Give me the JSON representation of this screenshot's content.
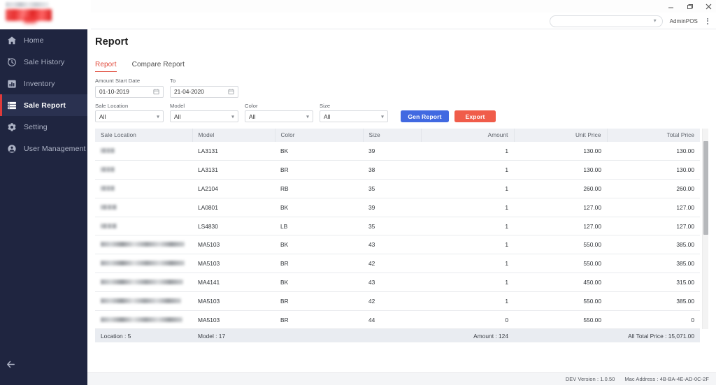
{
  "window": {
    "minimize_label": "Minimize",
    "maximize_label": "Maximize",
    "close_label": "Close"
  },
  "header": {
    "store_select_value": "",
    "store_select_placeholder": "",
    "user": "AdminPOS",
    "menu_label": "More options"
  },
  "brand": {
    "name_redacted": "",
    "logo_redacted": ""
  },
  "sidebar": {
    "items": [
      {
        "label": "Home",
        "icon": "home-icon",
        "active": false
      },
      {
        "label": "Sale History",
        "icon": "clock-history-icon",
        "active": false
      },
      {
        "label": "Inventory",
        "icon": "bar-chart-icon",
        "active": false
      },
      {
        "label": "Sale Report",
        "icon": "report-list-icon",
        "active": true
      },
      {
        "label": "Setting",
        "icon": "gear-icon",
        "active": false
      },
      {
        "label": "User Management",
        "icon": "user-icon",
        "active": false
      }
    ],
    "collapse_icon": "arrow-left-icon"
  },
  "main": {
    "page_title": "Report",
    "tabs": [
      {
        "label": "Report",
        "active": true
      },
      {
        "label": "Compare Report",
        "active": false
      }
    ],
    "filters": {
      "start_date_label": "Amount Start Date",
      "start_date_value": "01-10-2019",
      "end_date_label": "To",
      "end_date_value": "21-04-2020",
      "sale_location_label": "Sale Location",
      "sale_location_value": "All",
      "model_label": "Model",
      "model_value": "All",
      "color_label": "Color",
      "color_value": "All",
      "size_label": "Size",
      "size_value": "All"
    },
    "actions": {
      "gen_report_label": "Gen Report",
      "export_label": "Export"
    }
  },
  "table": {
    "columns": [
      "Sale Location",
      "Model",
      "Color",
      "Size",
      "Amount",
      "Unit Price",
      "Total Price"
    ],
    "rows": [
      {
        "sale_location": "",
        "location_blur_width": 20,
        "model": "LA3131",
        "color": "BK",
        "size": "39",
        "amount": "1",
        "unit_price": "130.00",
        "total_price": "130.00"
      },
      {
        "sale_location": "",
        "location_blur_width": 20,
        "model": "LA3131",
        "color": "BR",
        "size": "38",
        "amount": "1",
        "unit_price": "130.00",
        "total_price": "130.00"
      },
      {
        "sale_location": "",
        "location_blur_width": 20,
        "model": "LA2104",
        "color": "RB",
        "size": "35",
        "amount": "1",
        "unit_price": "260.00",
        "total_price": "260.00"
      },
      {
        "sale_location": "",
        "location_blur_width": 23,
        "model": "LA0801",
        "color": "BK",
        "size": "39",
        "amount": "1",
        "unit_price": "127.00",
        "total_price": "127.00"
      },
      {
        "sale_location": "",
        "location_blur_width": 23,
        "model": "LS4830",
        "color": "LB",
        "size": "35",
        "amount": "1",
        "unit_price": "127.00",
        "total_price": "127.00"
      },
      {
        "sale_location": "",
        "location_blur_width": 120,
        "model": "MA5103",
        "color": "BK",
        "size": "43",
        "amount": "1",
        "unit_price": "550.00",
        "total_price": "385.00"
      },
      {
        "sale_location": "",
        "location_blur_width": 120,
        "model": "MA5103",
        "color": "BR",
        "size": "42",
        "amount": "1",
        "unit_price": "550.00",
        "total_price": "385.00"
      },
      {
        "sale_location": "",
        "location_blur_width": 118,
        "model": "MA4141",
        "color": "BK",
        "size": "43",
        "amount": "1",
        "unit_price": "450.00",
        "total_price": "315.00"
      },
      {
        "sale_location": "",
        "location_blur_width": 115,
        "model": "MA5103",
        "color": "BR",
        "size": "42",
        "amount": "1",
        "unit_price": "550.00",
        "total_price": "385.00"
      },
      {
        "sale_location": "",
        "location_blur_width": 117,
        "model": "MA5103",
        "color": "BR",
        "size": "44",
        "amount": "0",
        "unit_price": "550.00",
        "total_price": "0"
      }
    ],
    "summary": {
      "location": "Location : 5",
      "model": "Model : 17",
      "amount": "Amount : 124",
      "total_price": "All Total Price : 15,071.00"
    }
  },
  "statusbar": {
    "version": "DEV Version : 1.0.50",
    "mac_address": "Mac Address :  4B-BA-4E-AD-0C-2F"
  },
  "colors": {
    "sidebar_bg": "#1f2540",
    "sidebar_active_bg": "#2a3150",
    "accent_red": "#e03a3a",
    "tab_active": "#e04b3c",
    "gen_report_blue": "#4169e1",
    "export_red": "#f05c4a",
    "table_header_bg": "#eef0f4",
    "table_footer_bg": "#e9ecf1"
  }
}
